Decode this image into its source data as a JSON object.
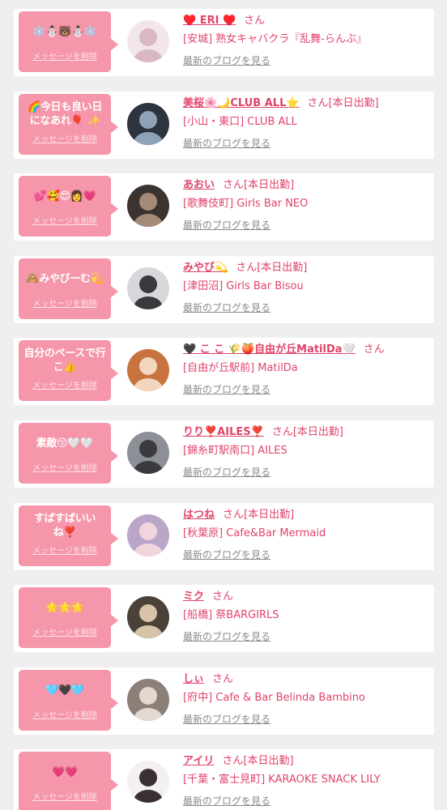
{
  "delete_label": "メッセージを削除",
  "blog_label": "最新のブログを見る",
  "san_label": "さん",
  "items": [
    {
      "message": "❄️⛄🐻⛄❄️",
      "name": "♥️ ERI ♥️",
      "status": "",
      "area": "[安城]",
      "shop": "熟女キャバクラ『乱舞-らんぶ』",
      "avatar": {
        "bg": "#f3e6ea",
        "fg": "#d9b8c2"
      }
    },
    {
      "message": "🌈今日も良い日になあれ🎈 ✨",
      "name": "美桜🌸🌙CLUB ALL⭐",
      "status": "[本日出勤]",
      "area": "[小山・東口]",
      "shop": "CLUB ALL",
      "avatar": {
        "bg": "#2d3440",
        "fg": "#8fa3b8"
      }
    },
    {
      "message": "💕🥰😍👩💗",
      "name": "あおい",
      "status": "[本日出勤]",
      "area": "[歌舞伎町]",
      "shop": "Girls Bar NEO",
      "avatar": {
        "bg": "#3b3330",
        "fg": "#a58a78"
      }
    },
    {
      "message": "🙈みやびーむ💫",
      "name": "みやび💫",
      "status": "[本日出勤]",
      "area": "[津田沼]",
      "shop": "Girls Bar Bisou",
      "avatar": {
        "bg": "#d8d8dc",
        "fg": "#3a3a3e"
      }
    },
    {
      "message": "自分のペースで行こ👍",
      "name": "🖤 こ こ 🌾🍑自由が丘MatilDa🤍",
      "status": "",
      "area": "[自由が丘駅前]",
      "shop": "MatilDa",
      "avatar": {
        "bg": "#c8733e",
        "fg": "#f2d6c0"
      }
    },
    {
      "message": "素敵😚🤍🤍",
      "name": "りり❣️AILES❣️",
      "status": "[本日出勤]",
      "area": "[錦糸町駅南口]",
      "shop": "AILES",
      "avatar": {
        "bg": "#8c8f96",
        "fg": "#3b3b3f"
      }
    },
    {
      "message": "すばすばいいね❣️",
      "name": "はつね",
      "status": "[本日出勤]",
      "area": "[秋葉原]",
      "shop": "Cafe&Bar Mermaid",
      "avatar": {
        "bg": "#b9a6c9",
        "fg": "#f1d5dd"
      }
    },
    {
      "message": "🌟🌟🌟",
      "name": "ミク",
      "status": "",
      "area": "[船橋]",
      "shop": "祭BARGIRLS",
      "avatar": {
        "bg": "#4a4238",
        "fg": "#d7c3a8"
      }
    },
    {
      "message": "🩵🖤🩵",
      "name": "しぃ",
      "status": "",
      "area": "[府中]",
      "shop": "Cafe & Bar Belinda Bambino",
      "avatar": {
        "bg": "#8b7f78",
        "fg": "#e4d9d0"
      }
    },
    {
      "message": "💗💗",
      "name": "アイリ",
      "status": "[本日出勤]",
      "area": "[千葉・富士見町]",
      "shop": "KARAOKE SNACK LILY",
      "avatar": {
        "bg": "#f4f0f2",
        "fg": "#3a3032"
      }
    }
  ]
}
